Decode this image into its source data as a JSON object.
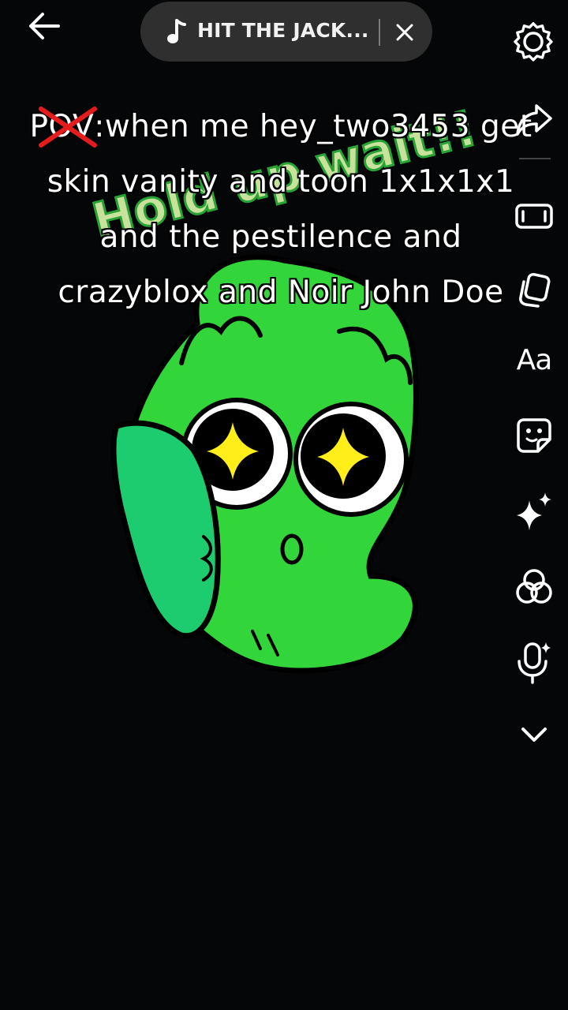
{
  "music": {
    "title": "HIT THE JACK...",
    "close_label": "×"
  },
  "caption": {
    "crossed_word": "POV",
    "text": ":when me hey_two3453 get skin vanity and toon 1x1x1x1 and the pestilence and crazyblox and Noir John Doe"
  },
  "artwork": {
    "watermark_text": "Hold up wait!!",
    "colors": {
      "body": "#33d63a",
      "hand": "#1ccc6e",
      "star": "#ffee1a",
      "outline": "#000000"
    }
  },
  "side_tools": {
    "text_tool_label": "Aa",
    "icons": [
      "settings-icon",
      "share-icon",
      "aspect-ratio-icon",
      "duplicate-icon",
      "text-icon",
      "sticker-icon",
      "effects-icon",
      "filters-icon",
      "voice-effect-icon",
      "chevron-down-icon"
    ]
  },
  "colors": {
    "background": "#050607",
    "pill": "#2f2f2f",
    "cross_red": "#e51c1c"
  }
}
